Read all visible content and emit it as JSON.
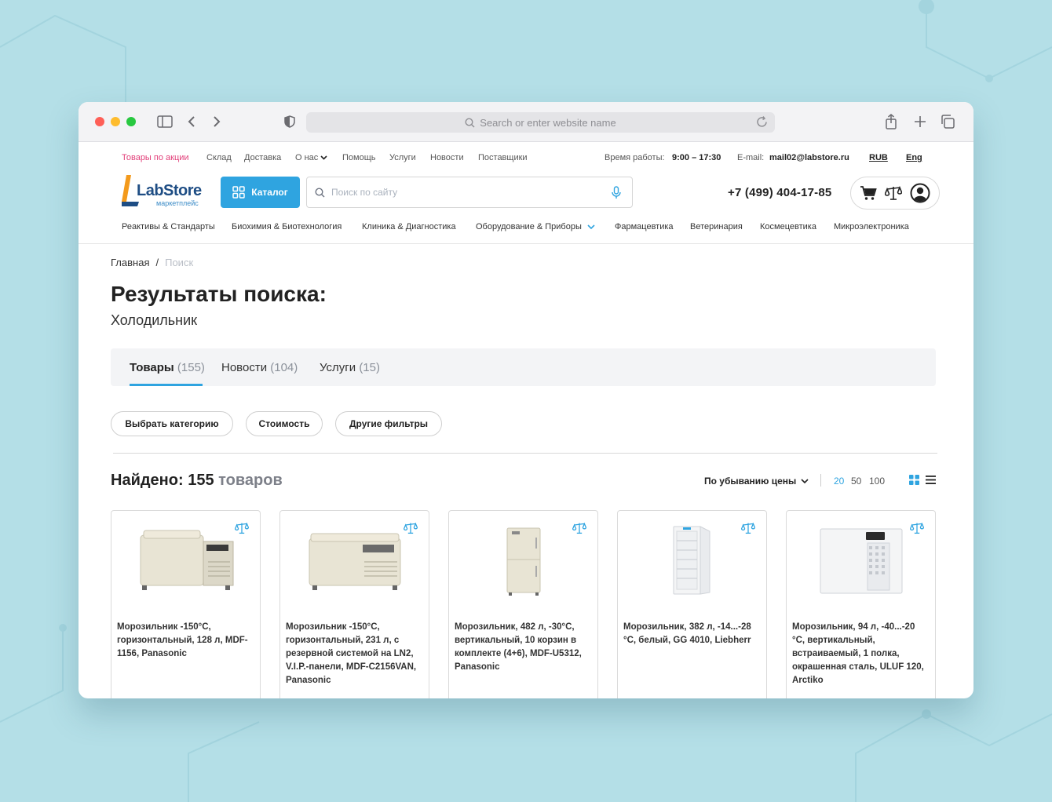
{
  "browser": {
    "url_placeholder": "Search or enter website name"
  },
  "topbar": {
    "promo": "Товары по акции",
    "links": [
      "Склад",
      "Доставка",
      "О нас",
      "Помощь",
      "Услуги",
      "Новости",
      "Поставщики"
    ],
    "hours_label": "Время работы:",
    "hours_value": "9:00 – 17:30",
    "email_label": "E-mail:",
    "email_value": "mail02@labstore.ru",
    "currency": "RUB",
    "language": "Eng"
  },
  "header": {
    "logo_text": "LabStore",
    "logo_sub": "маркетплейс",
    "catalog_label": "Каталог",
    "search_placeholder": "Поиск по сайту",
    "phone": "+7 (499) 404-17-85"
  },
  "catnav": [
    "Реактивы & Стандарты",
    "Биохимия & Биотехнология",
    "Клиника & Диагностика",
    "Оборудование & Приборы",
    "Фармацевтика",
    "Ветеринария",
    "Космецевтика",
    "Микроэлектроника"
  ],
  "breadcrumb": {
    "home": "Главная",
    "sep": "/",
    "current": "Поиск"
  },
  "page": {
    "title": "Результаты поиска:",
    "query": "Холодильник"
  },
  "tabs": [
    {
      "label": "Товары",
      "count": "(155)"
    },
    {
      "label": "Новости",
      "count": "(104)"
    },
    {
      "label": "Услуги",
      "count": "(15)"
    }
  ],
  "filters": [
    "Выбрать категорию",
    "Стоимость",
    "Другие фильтры"
  ],
  "results": {
    "found_label": "Найдено: 155",
    "found_unit": "товаров",
    "sort_label": "По убыванию цены",
    "per_page": [
      "20",
      "50",
      "100"
    ]
  },
  "products": [
    {
      "name": "Морозильник -150°C, горизонтальный, 128 л, MDF-1156, Panasonic"
    },
    {
      "name": "Морозильник -150°C, горизонтальный, 231 л, с резервной системой на LN2, V.I.P.-панели, MDF-C2156VAN, Panasonic"
    },
    {
      "name": "Морозильник, 482 л, -30°C, вертикальный, 10 корзин в комплекте (4+6), MDF-U5312, Panasonic"
    },
    {
      "name": "Морозильник, 382 л, -14...-28 °C, белый, GG 4010, Liebherr"
    },
    {
      "name": "Морозильник, 94 л, -40...-20 °C, вертикальный, встраиваемый, 1 полка, окрашенная сталь, ULUF 120, Arctiko"
    }
  ],
  "colors": {
    "accent": "#2fa4e0",
    "promo": "#e2407a",
    "brand": "#1e4d84"
  }
}
